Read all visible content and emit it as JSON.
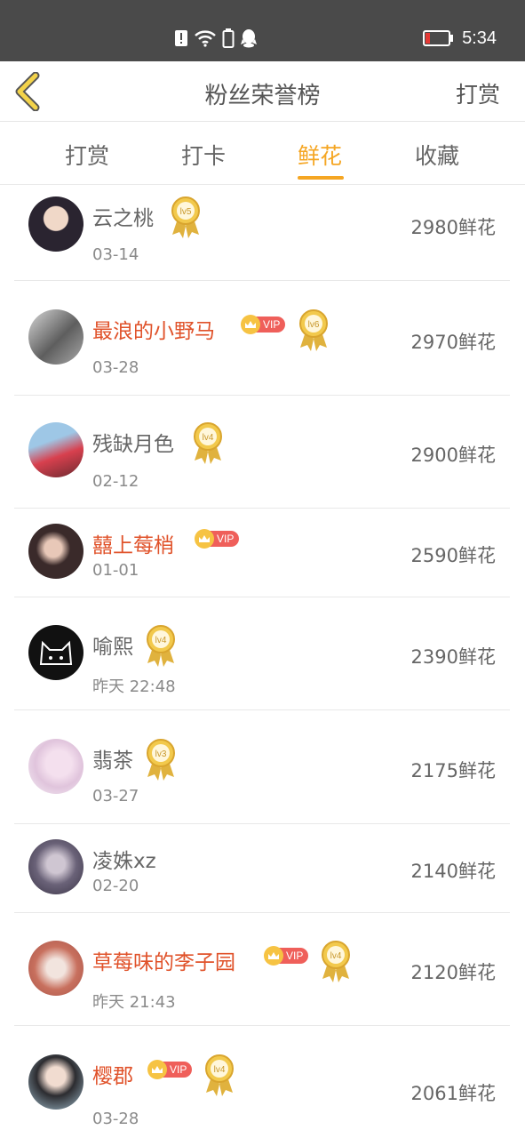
{
  "status_bar": {
    "time": "5:34"
  },
  "header": {
    "title": "粉丝荣誉榜",
    "action": "打赏"
  },
  "tabs": [
    {
      "label": "打赏"
    },
    {
      "label": "打卡"
    },
    {
      "label": "鲜花"
    },
    {
      "label": "收藏"
    }
  ],
  "active_tab": "鲜花",
  "vip_label": "VIP",
  "colors": {
    "accent": "#f5a623",
    "vip_name": "#e0522a",
    "status_bar": "#4a4a4a"
  },
  "list": [
    {
      "name": "云之桃",
      "date": "03-14",
      "amount": "2980鲜花",
      "vip": false,
      "level": "lv5"
    },
    {
      "name": "最浪的小野马",
      "date": "03-28",
      "amount": "2970鲜花",
      "vip": true,
      "level": "lv6"
    },
    {
      "name": "残缺月色",
      "date": "02-12",
      "amount": "2900鲜花",
      "vip": false,
      "level": "lv4"
    },
    {
      "name": "囍上莓梢",
      "date": "01-01",
      "amount": "2590鲜花",
      "vip": true,
      "level": ""
    },
    {
      "name": "喻熙",
      "date": "昨天 22:48",
      "amount": "2390鲜花",
      "vip": false,
      "level": "lv4"
    },
    {
      "name": "翡茶",
      "date": "03-27",
      "amount": "2175鲜花",
      "vip": false,
      "level": "lv3"
    },
    {
      "name": "凌姝xz",
      "date": "02-20",
      "amount": "2140鲜花",
      "vip": false,
      "level": ""
    },
    {
      "name": "草莓味的李子园",
      "date": "昨天 21:43",
      "amount": "2120鲜花",
      "vip": true,
      "level": "lv4"
    },
    {
      "name": "樱郡",
      "date": "03-28",
      "amount": "2061鲜花",
      "vip": true,
      "level": "lv4"
    }
  ]
}
